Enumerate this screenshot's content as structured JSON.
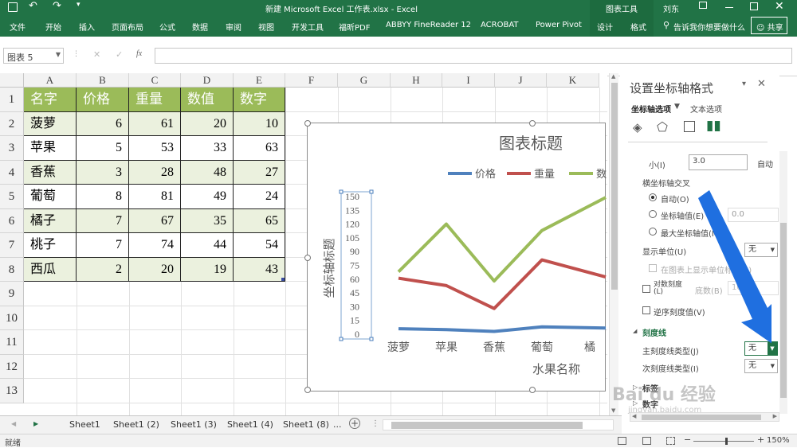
{
  "title_bar": {
    "quick_icons": [
      "excel-save-icon",
      "undo-icon",
      "redo-icon"
    ],
    "doc_title": "新建 Microsoft Excel 工作表.xlsx  -  Excel",
    "chart_tools": "图表工具",
    "user": "刘东"
  },
  "ribbon": {
    "tabs": [
      "文件",
      "开始",
      "插入",
      "页面布局",
      "公式",
      "数据",
      "审阅",
      "视图",
      "开发工具",
      "福昕PDF",
      "ABBYY FineReader 12",
      "ACROBAT",
      "Power Pivot"
    ],
    "context_tabs": [
      "设计",
      "格式"
    ],
    "tell_me": "告诉我你想要做什么",
    "share": "共享"
  },
  "formula": {
    "name_box": "图表 5",
    "fx": "fx",
    "value": ""
  },
  "columns": [
    "A",
    "B",
    "C",
    "D",
    "E",
    "F",
    "G",
    "H",
    "I",
    "J",
    "K"
  ],
  "rows": [
    "1",
    "2",
    "3",
    "4",
    "5",
    "6",
    "7",
    "8",
    "9",
    "10",
    "11",
    "12",
    "13"
  ],
  "table": {
    "header": [
      "名字",
      "价格",
      "重量",
      "数值",
      "数字"
    ],
    "rows": [
      [
        "菠萝",
        "6",
        "61",
        "20",
        "10"
      ],
      [
        "苹果",
        "5",
        "53",
        "33",
        "63"
      ],
      [
        "香蕉",
        "3",
        "28",
        "48",
        "27"
      ],
      [
        "葡萄",
        "8",
        "81",
        "49",
        "24"
      ],
      [
        "橘子",
        "7",
        "67",
        "35",
        "65"
      ],
      [
        "桃子",
        "7",
        "74",
        "44",
        "54"
      ],
      [
        "西瓜",
        "2",
        "20",
        "19",
        "43"
      ]
    ]
  },
  "chart_data": {
    "type": "line",
    "title": "图表标题",
    "xlabel": "水果名称",
    "ylabel": "坐标轴标题",
    "categories": [
      "菠萝",
      "苹果",
      "香蕉",
      "葡萄",
      "橘"
    ],
    "yticks": [
      "150",
      "135",
      "120",
      "105",
      "90",
      "75",
      "60",
      "45",
      "30",
      "15",
      "0"
    ],
    "ylim": [
      0,
      150
    ],
    "series": [
      {
        "name": "价格",
        "color": "#4f81bd",
        "values": [
          6,
          5,
          3,
          8,
          7
        ]
      },
      {
        "name": "重量",
        "color": "#c0504d",
        "values": [
          61,
          53,
          28,
          81,
          67
        ]
      },
      {
        "name": "数",
        "color": "#9bbb59",
        "values": [
          68,
          120,
          58,
          113,
          140
        ]
      }
    ]
  },
  "pane": {
    "title": "设置坐标轴格式",
    "tab1": "坐标轴选项",
    "tab2": "文本选项",
    "min_label": "小(I)",
    "min_value": "3.0",
    "min_auto": "自动",
    "cross_heading": "横坐标轴交叉",
    "r_auto": "自动(O)",
    "r_axis": "坐标轴值(E)",
    "axis_value": "0.0",
    "r_max": "最大坐标轴值(M)",
    "unit_label": "显示单位(U)",
    "unit_value": "无",
    "chk_show": "在图表上显示单位标签(S)",
    "chk_log": "对数刻度(L)",
    "base_label": "底数(B)",
    "base_value": "10",
    "chk_reverse": "逆序刻度值(V)",
    "ticks_heading": "刻度线",
    "major_label": "主刻度线类型(J)",
    "major_value": "无",
    "minor_label": "次刻度线类型(I)",
    "minor_value": "无",
    "labels_heading": "标签",
    "numbers_heading": "数字"
  },
  "sheets": [
    "Sheet1",
    "Sheet1 (2)",
    "Sheet1 (3)",
    "Sheet1 (4)",
    "Sheet1 (8)",
    "..."
  ],
  "status": {
    "ready": "就绪",
    "zoom": "150%"
  },
  "watermark": {
    "text": "Bai du 经验",
    "sub": "jingyan.baidu.com"
  }
}
